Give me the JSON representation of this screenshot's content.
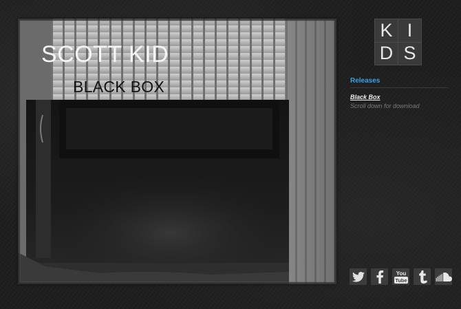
{
  "cover": {
    "artist": "SCOTT KID",
    "title": "BLACK BOX"
  },
  "logo": {
    "letters": [
      "K",
      "I",
      "D",
      "S"
    ]
  },
  "sidebar": {
    "heading": "Releases",
    "releases": [
      {
        "label": "Black Box",
        "note": "Scroll down for download"
      }
    ]
  },
  "social": {
    "icons": [
      "twitter-icon",
      "facebook-icon",
      "youtube-icon",
      "tumblr-icon",
      "soundcloud-icon"
    ],
    "youtube_text_top": "You",
    "youtube_text_bottom": "Tube"
  },
  "colors": {
    "accent": "#3aa1e3",
    "background": "#1f1f1f",
    "icon_bg": "#3c3c3c"
  }
}
